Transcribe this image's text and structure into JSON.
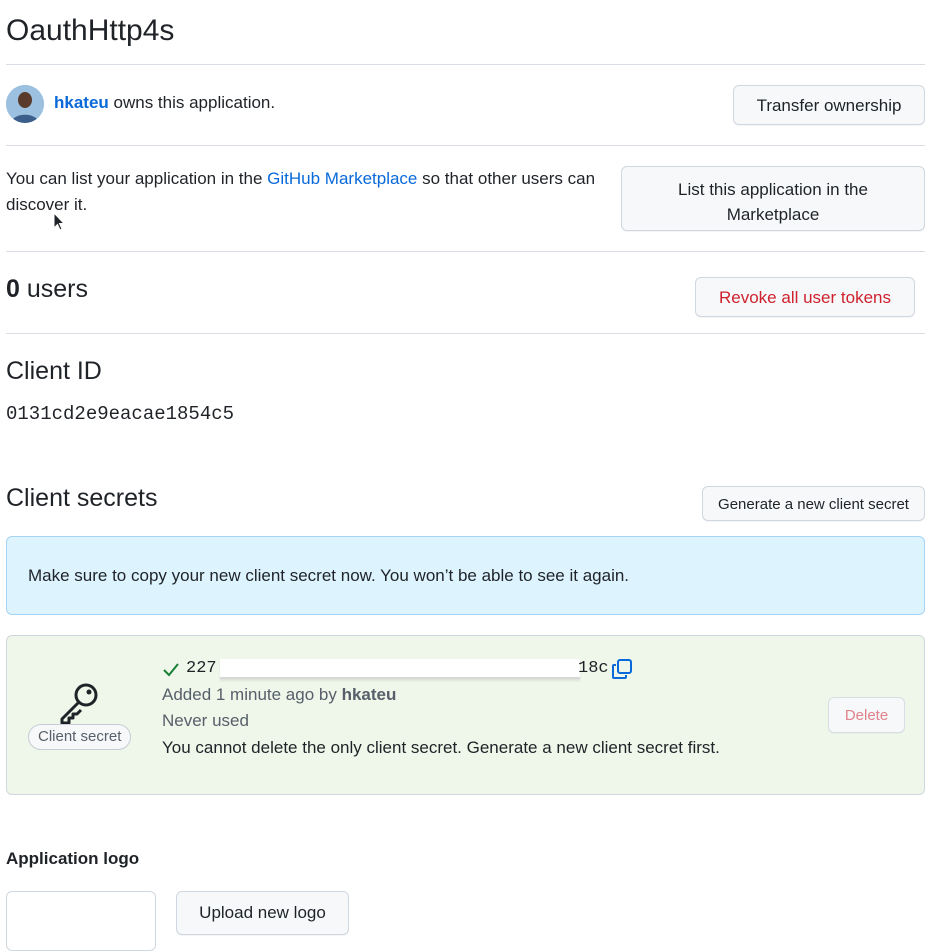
{
  "app": {
    "title": "OauthHttp4s"
  },
  "owner": {
    "username": "hkateu",
    "owns_text": " owns this application.",
    "transfer_label": "Transfer ownership"
  },
  "marketplace": {
    "text_before": "You can list your application in the ",
    "link_text": "GitHub Marketplace",
    "text_after": " so that other users can discover it.",
    "button_line1": "List this application in the",
    "button_line2": "Marketplace"
  },
  "users": {
    "count": "0",
    "label": " users",
    "revoke_label": "Revoke all user tokens",
    "revoke_color": "#cf222e"
  },
  "client_id": {
    "title": "Client ID",
    "value": "0131cd2e9eacae1854c5"
  },
  "client_secrets": {
    "title": "Client secrets",
    "generate_label": "Generate a new client secret",
    "flash_message": "Make sure to copy your new client secret now. You won’t be able to see it again.",
    "secret": {
      "badge_label": "Client secret",
      "prefix": "227",
      "suffix": "18c",
      "added_text": "Added 1 minute ago by ",
      "added_by": "hkateu",
      "usage": "Never used",
      "delete_note": "You cannot delete the only client secret. Generate a new client secret first.",
      "delete_label": "Delete",
      "icons": [
        "key-icon",
        "check-icon",
        "copy-icon"
      ]
    }
  },
  "application_logo": {
    "title": "Application logo",
    "upload_label": "Upload new logo"
  },
  "colors": {
    "link": "#0969da",
    "flash_bg": "#ddf4ff",
    "secret_bg": "#eef7ea",
    "check": "#1a7f37"
  }
}
